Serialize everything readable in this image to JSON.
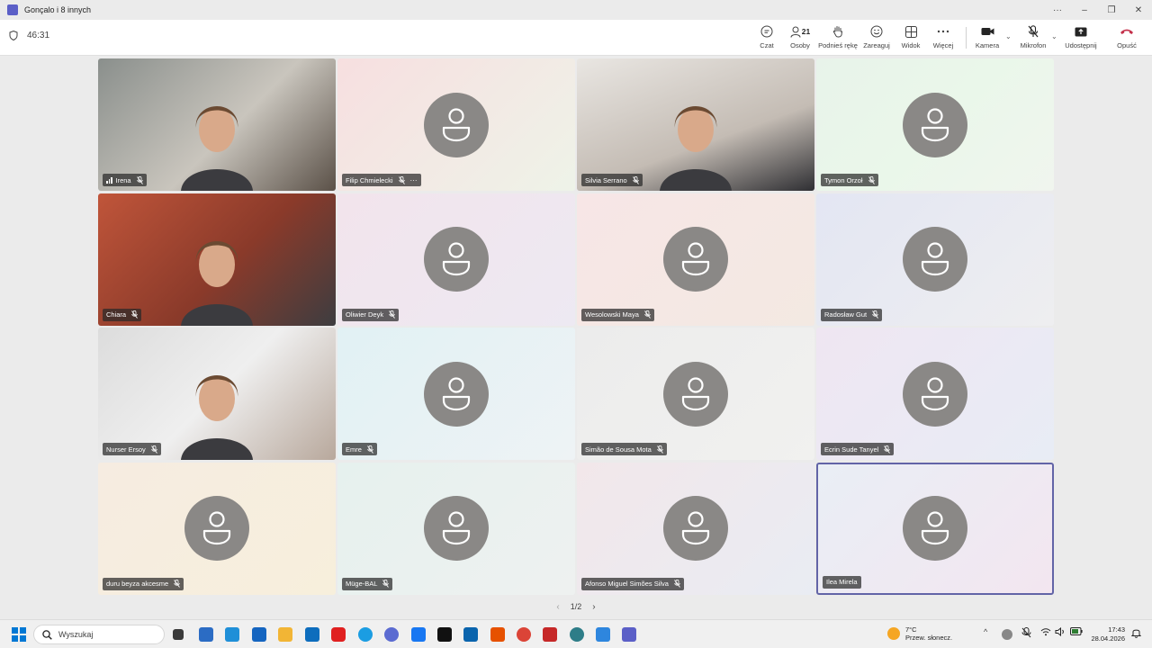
{
  "window": {
    "title": "Gonçalo i 8 innych",
    "more_label": "···",
    "minimize_label": "–",
    "restore_label": "❐",
    "close_label": "✕"
  },
  "toolbar": {
    "timer": "46:31",
    "chat_label": "Czat",
    "people_label": "Osoby",
    "people_count": "21",
    "raise_hand_label": "Podnieś rękę",
    "react_label": "Zareaguj",
    "view_label": "Widok",
    "more_label": "Więcej",
    "camera_label": "Kamera",
    "mic_label": "Mikrofon",
    "share_label": "Udostępnij",
    "leave_label": "Opuść"
  },
  "participants": [
    {
      "name": "Irena",
      "video": true
    },
    {
      "name": "Filip Chmielecki",
      "video": false
    },
    {
      "name": "Silvia Serrano",
      "video": true
    },
    {
      "name": "Tymon Orzoł",
      "video": false
    },
    {
      "name": "Chiara",
      "video": true
    },
    {
      "name": "Oliwier Deyk",
      "video": false
    },
    {
      "name": "Wesolowski Maya",
      "video": false
    },
    {
      "name": "Radosław Gut",
      "video": false
    },
    {
      "name": "Nurser Ersoy",
      "video": true
    },
    {
      "name": "Emre",
      "video": false
    },
    {
      "name": "Simão de Sousa Mota",
      "video": false
    },
    {
      "name": "Ecrin Sude Tanyel",
      "video": false
    },
    {
      "name": "duru beyza akcesme",
      "video": false
    },
    {
      "name": "Müge-BAL",
      "video": false
    },
    {
      "name": "Afonso Miguel Simões Silva",
      "video": false
    },
    {
      "name": "Ilea Mirela",
      "video": false
    }
  ],
  "pager": {
    "label": "1/2",
    "prev": "‹",
    "next": "›"
  },
  "taskbar": {
    "search_placeholder": "Wyszukaj",
    "weather_temp": "7°C",
    "weather_desc": "Przew. słonecz.",
    "time": "17:43",
    "date": "28.04.2026",
    "tray_chevron": "^"
  },
  "colors": {
    "accent": "#6264a7",
    "leave": "#c4314b",
    "avatar": "#8a8886"
  }
}
